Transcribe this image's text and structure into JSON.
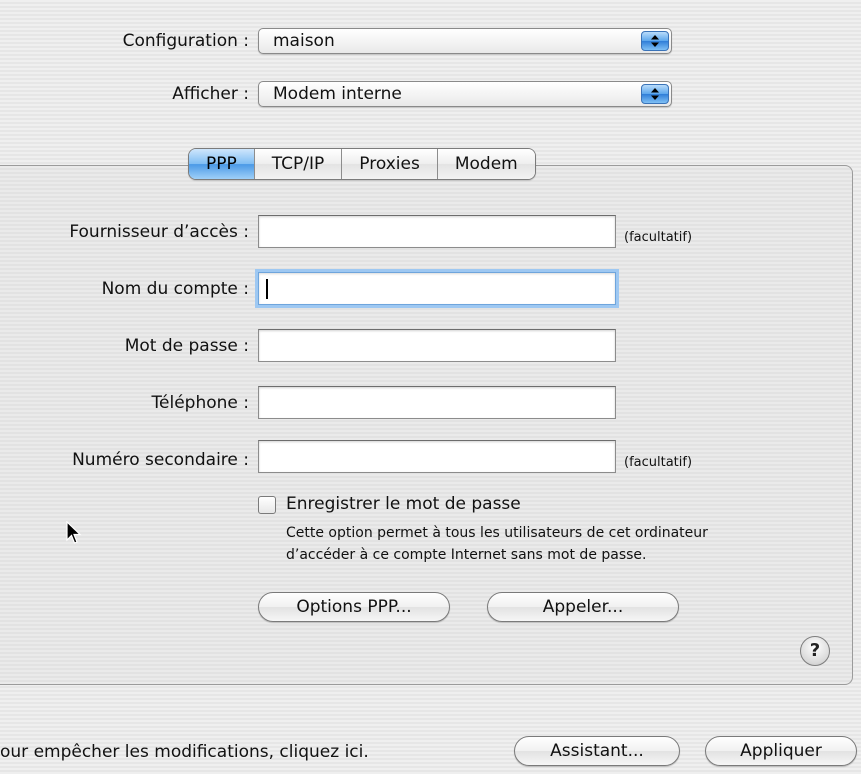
{
  "header": {
    "configuration_label": "Configuration :",
    "configuration_value": "maison",
    "show_label": "Afficher :",
    "show_value": "Modem interne"
  },
  "tabs": [
    {
      "label": "PPP",
      "selected": true
    },
    {
      "label": "TCP/IP",
      "selected": false
    },
    {
      "label": "Proxies",
      "selected": false
    },
    {
      "label": "Modem",
      "selected": false
    }
  ],
  "form": {
    "provider_label": "Fournisseur d’accès :",
    "provider_value": "",
    "provider_hint": "(facultatif)",
    "account_label": "Nom du compte :",
    "account_value": "",
    "password_label": "Mot de passe :",
    "password_value": "",
    "phone_label": "Téléphone :",
    "phone_value": "",
    "alt_number_label": "Numéro secondaire :",
    "alt_number_value": "",
    "alt_number_hint": "(facultatif)"
  },
  "save_password": {
    "label": "Enregistrer le mot de passe",
    "checked": false,
    "description_line1": "Cette option permet à tous les utilisateurs de cet ordinateur",
    "description_line2": "d’accéder à ce compte Internet sans mot de passe."
  },
  "buttons": {
    "ppp_options": "Options PPP...",
    "dial": "Appeler...",
    "help": "?",
    "assistant": "Assistant...",
    "apply": "Appliquer"
  },
  "footer": {
    "lock_text": "our empêcher les modifications, cliquez ici."
  },
  "icons": {
    "popup_arrows": "up-down-arrows-icon",
    "help": "help-icon",
    "cursor": "mouse-pointer-icon"
  },
  "colors": {
    "accent": "#4a99e6",
    "focus_ring": "#9ec8f2"
  }
}
